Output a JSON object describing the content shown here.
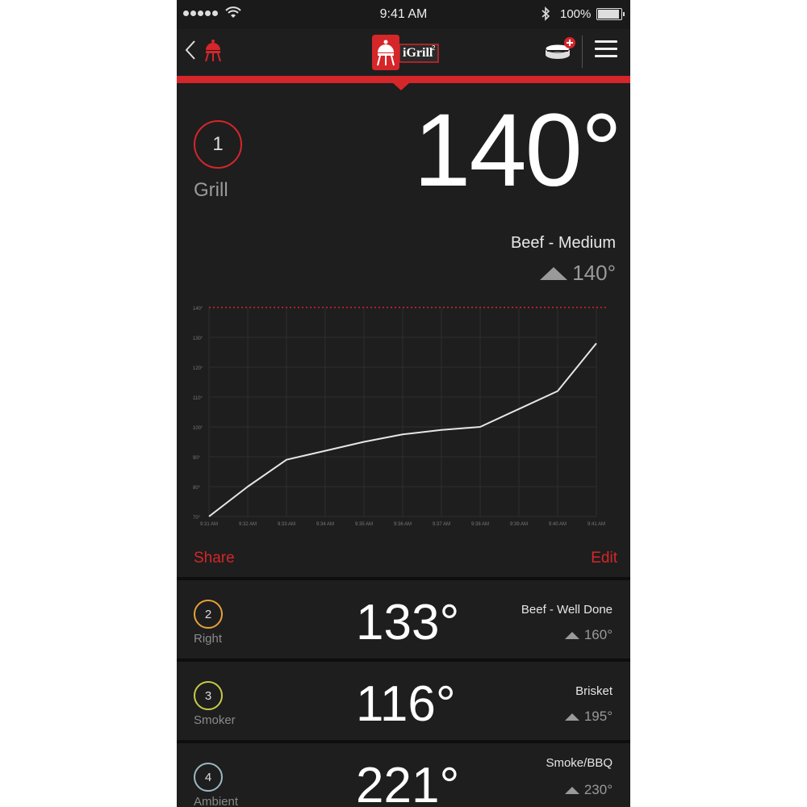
{
  "status": {
    "time": "9:41 AM",
    "battery": "100%",
    "battery_level": 1.0
  },
  "nav": {
    "logo_text": "iGrill",
    "logo_sup": "2"
  },
  "main": {
    "probe_number": "1",
    "probe_name": "Grill",
    "temperature": "140°",
    "preset": "Beef - Medium",
    "target": "140°",
    "share_label": "Share",
    "edit_label": "Edit"
  },
  "probes": [
    {
      "number": "2",
      "name": "Right",
      "temperature": "133°",
      "preset": "Beef - Well Done",
      "target": "160°",
      "color": "#e6a03a"
    },
    {
      "number": "3",
      "name": "Smoker",
      "temperature": "116°",
      "preset": "Brisket",
      "target": "195°",
      "color": "#c9c94a"
    },
    {
      "number": "4",
      "name": "Ambient",
      "temperature": "221°",
      "preset": "Smoke/BBQ",
      "target": "230°",
      "color": "#9ab8c4"
    }
  ],
  "colors": {
    "accent": "#d5262a",
    "background": "#1e1e1e",
    "line": "#e6e6e6"
  },
  "chart_data": {
    "type": "line",
    "x": [
      "9:31 AM",
      "9:32 AM",
      "9:33 AM",
      "9:34 AM",
      "9:35 AM",
      "9:36 AM",
      "9:37 AM",
      "9:38 AM",
      "9:39 AM",
      "9:40 AM",
      "9:41 AM"
    ],
    "yticks": [
      "140°",
      "130°",
      "120°",
      "110°",
      "100°",
      "90°",
      "80°",
      "70°"
    ],
    "series": [
      {
        "values": [
          70,
          80,
          89,
          92,
          95,
          97.5,
          99,
          100,
          106,
          112,
          128
        ]
      }
    ],
    "ylim": [
      70,
      140
    ],
    "target_line": 140,
    "grid": true
  }
}
